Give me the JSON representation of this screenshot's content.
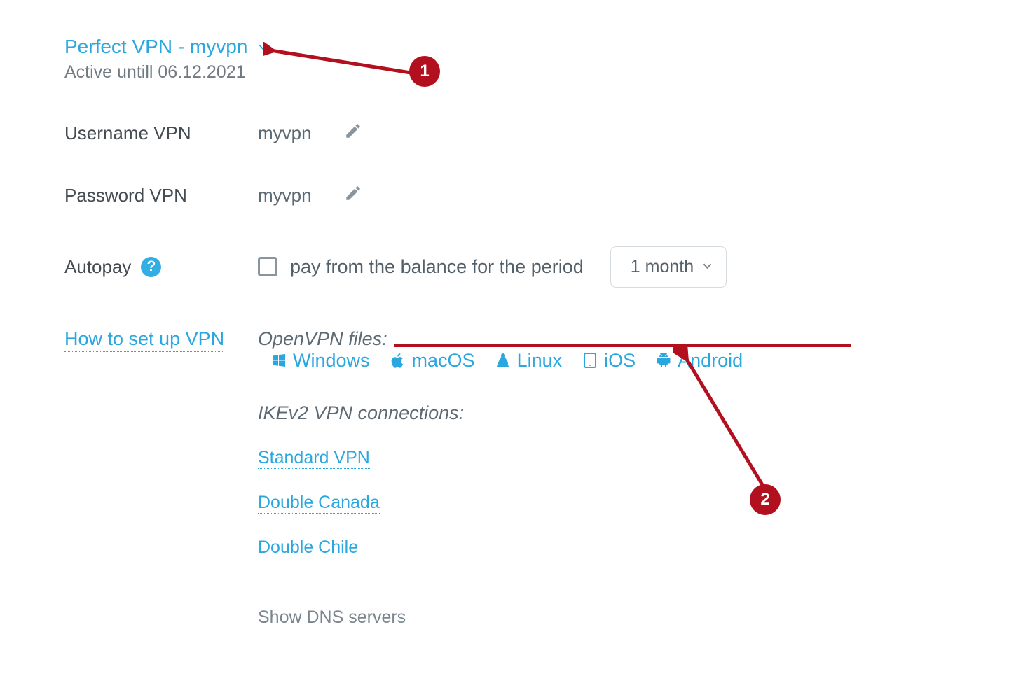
{
  "header": {
    "title": "Perfect VPN - myvpn",
    "active_text": "Active untill 06.12.2021"
  },
  "fields": {
    "username_label": "Username VPN",
    "username_value": "myvpn",
    "password_label": "Password VPN",
    "password_value": "myvpn"
  },
  "autopay": {
    "label": "Autopay",
    "checkbox_label": "pay from the balance for the period",
    "period_selected": "1 month"
  },
  "setup": {
    "how_to": "How to set up VPN",
    "openvpn_label": "OpenVPN files:",
    "os": {
      "windows": "Windows",
      "macos": "macOS",
      "linux": "Linux",
      "ios": "iOS",
      "android": "Android"
    },
    "ikev2_label": "IKEv2 VPN connections:",
    "connections": {
      "standard": "Standard VPN",
      "canada": "Double Canada",
      "chile": "Double Chile"
    },
    "dns": "Show DNS servers"
  },
  "annotations": {
    "b1": "1",
    "b2": "2"
  }
}
